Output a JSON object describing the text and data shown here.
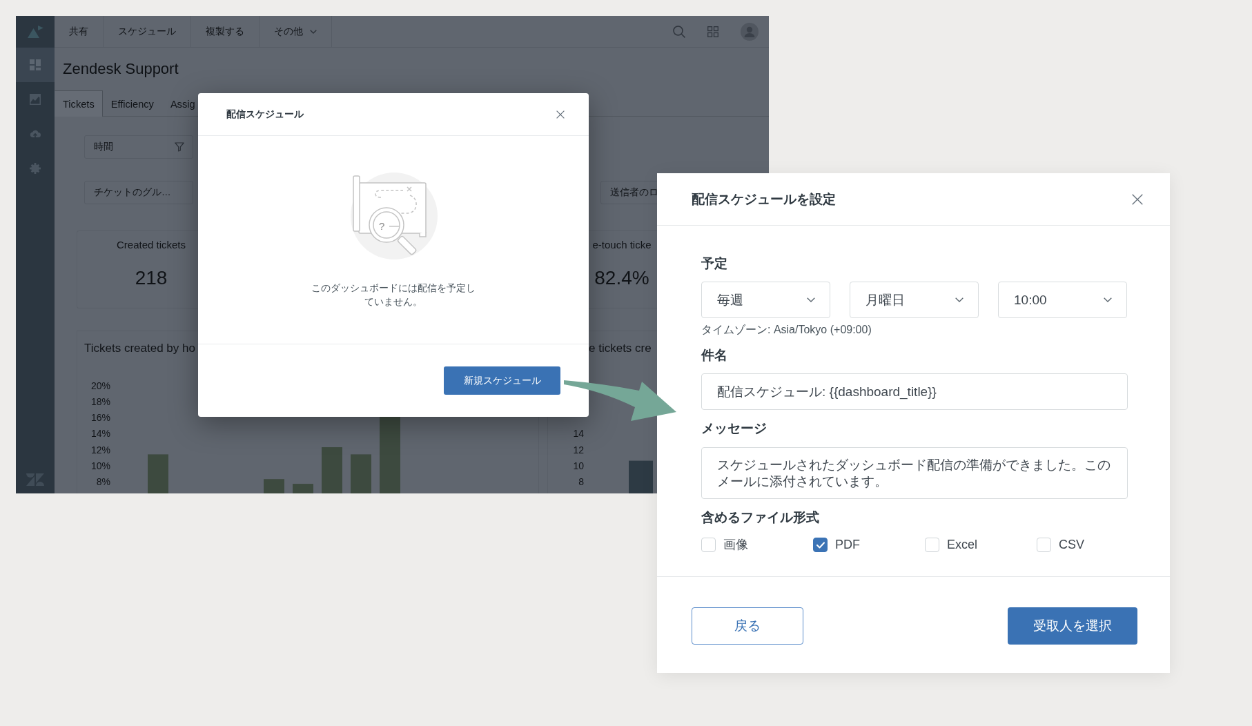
{
  "app": {
    "sidebar_items": [
      {
        "selected": true
      },
      {
        "selected": false
      },
      {
        "selected": false
      },
      {
        "selected": false
      }
    ],
    "toolbar": [
      {
        "label": "共有",
        "kind": "plain"
      },
      {
        "label": "スケジュール",
        "kind": "plain"
      },
      {
        "label": "複製する",
        "kind": "plain"
      },
      {
        "label": "その他",
        "kind": "menu"
      }
    ],
    "title": "Zendesk Support",
    "tabs": [
      {
        "label": "Tickets",
        "selected": true
      },
      {
        "label": "Efficiency",
        "selected": false
      },
      {
        "label": "Assig",
        "selected": false
      }
    ],
    "filter_rows": [
      {
        "filters": [
          {
            "label": "時間",
            "kind": "filter"
          }
        ]
      },
      {
        "filters": [
          {
            "label": "チケットのグル…",
            "kind": "plain"
          },
          {
            "label": "送信者のロ",
            "kind": "plain"
          }
        ]
      }
    ],
    "metrics": [
      {
        "label": "Created tickets",
        "value": "218"
      },
      {
        "label": "e-touch ticke",
        "value": "82.4%"
      }
    ],
    "charts": [
      {
        "title": "Tickets created by ho",
        "y_axis_labels": [
          "20%",
          "18%",
          "16%",
          "14%",
          "12%",
          "10%",
          "8%"
        ]
      },
      {
        "title": "e tickets cre",
        "y_axis_labels": [
          "14",
          "12",
          "10",
          "8"
        ]
      }
    ]
  },
  "schedules_dialog": {
    "title": "配信スケジュール",
    "illustration_mark": "?",
    "message": "このダッシュボードには配信を予定していません。",
    "new_button": "新規スケジュール"
  },
  "schedule_dialog": {
    "title": "配信スケジュールを設定",
    "schedule_label": "予定",
    "dropdowns": [
      {
        "value": "毎週"
      },
      {
        "value": "月曜日"
      },
      {
        "value": "10:00"
      }
    ],
    "timezone": "タイムゾーン: Asia/Tokyo (+09:00)",
    "subject_label": "件名",
    "subject": "配信スケジュール: {{dashboard_title}}",
    "message_label": "メッセージ",
    "message": "スケジュールされたダッシュボード配信の準備ができました。このメールに添付されています。",
    "formats_label": "含めるファイル形式",
    "formats": [
      {
        "label": "画像",
        "checked": false
      },
      {
        "label": "PDF",
        "checked": true
      },
      {
        "label": "Excel",
        "checked": false
      },
      {
        "label": "CSV",
        "checked": false
      }
    ],
    "back_button": "戻る",
    "next_button": "受取人を選択"
  }
}
